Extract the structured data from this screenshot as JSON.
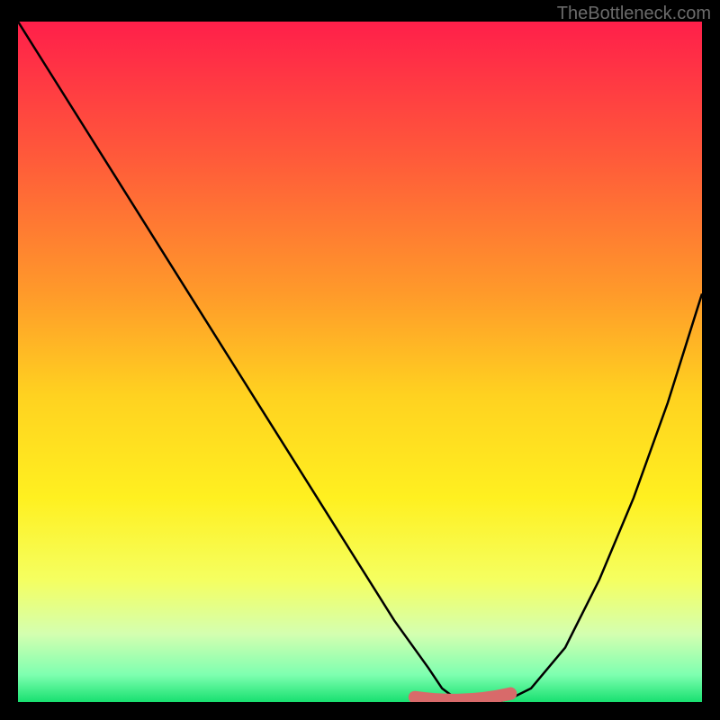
{
  "watermark": "TheBottleneck.com",
  "chart_data": {
    "type": "line",
    "title": "",
    "xlabel": "",
    "ylabel": "",
    "x": [
      0,
      5,
      10,
      15,
      20,
      25,
      30,
      35,
      40,
      45,
      50,
      55,
      60,
      62,
      64,
      66,
      68,
      70,
      72,
      75,
      80,
      85,
      90,
      95,
      100
    ],
    "values": [
      100,
      92,
      84,
      76,
      68,
      60,
      52,
      44,
      36,
      28,
      20,
      12,
      5,
      2,
      0.5,
      0,
      0,
      0,
      0.5,
      2,
      8,
      18,
      30,
      44,
      60
    ],
    "xlim": [
      0,
      100
    ],
    "ylim": [
      0,
      100
    ],
    "highlight_band": {
      "x0": 58,
      "x1": 72,
      "y": 1.5
    },
    "gradient": {
      "stops": [
        {
          "t": 0.0,
          "c": "#ff1f4a"
        },
        {
          "t": 0.2,
          "c": "#ff5a3a"
        },
        {
          "t": 0.4,
          "c": "#ff9a2a"
        },
        {
          "t": 0.55,
          "c": "#ffd220"
        },
        {
          "t": 0.7,
          "c": "#fff020"
        },
        {
          "t": 0.82,
          "c": "#f5ff60"
        },
        {
          "t": 0.9,
          "c": "#d4ffb0"
        },
        {
          "t": 0.96,
          "c": "#7effb0"
        },
        {
          "t": 1.0,
          "c": "#18e070"
        }
      ]
    }
  }
}
